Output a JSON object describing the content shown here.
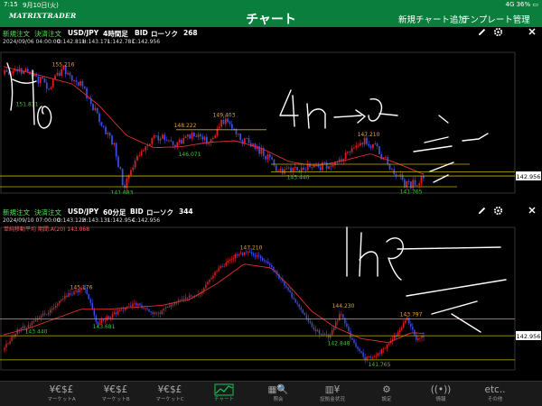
{
  "status": {
    "time": "7:15",
    "date": "9月10日(火)",
    "right": "4G 36% ▭"
  },
  "header": {
    "logo": "MATRIXTRADER",
    "title": "チャート",
    "add_chart": "新規チャート追加",
    "template": "テンプレート管理"
  },
  "panels": [
    {
      "new_order": "新規注文",
      "settle_order": "決済注文",
      "pair": "USD/JPY",
      "timeframe": "4時間足",
      "side": "BID",
      "chart_kind": "ローソク",
      "count": "268",
      "info": {
        "datetime": "2024/09/06 04:00:00",
        "open": "O:142.811",
        "high": "H:143.171",
        "low": "L:142.781",
        "close": "C:142.956"
      },
      "sma_label": "",
      "current_price": "142.956",
      "handwriting": "4h→",
      "annotations": [
        "155.216",
        "151.811",
        "148.222",
        "149.403",
        "146.071",
        "147.210",
        "143.440",
        "141.683",
        "141.765"
      ]
    },
    {
      "new_order": "新規注文",
      "settle_order": "決済注文",
      "pair": "USD/JPY",
      "timeframe": "60分足",
      "side": "BID",
      "chart_kind": "ローソク",
      "count": "344",
      "info": {
        "datetime": "2024/09/10 07:00:00",
        "open": "O:143.122",
        "high": "H:143.131",
        "low": "L:142.954",
        "close": "C:142.956"
      },
      "sma_label": "単純移動平均 期間:A(20) 143.068",
      "current_price": "142.956",
      "handwriting": "1h→",
      "annotations": [
        "147.210",
        "145.176",
        "143.440",
        "143.681",
        "144.230",
        "143.797",
        "142.848",
        "141.765"
      ]
    }
  ],
  "colors": {
    "bull": "#e02020",
    "bear": "#3a4ee8",
    "sma": "#e03030",
    "level": "#c8b400",
    "header": "#0a7e3c",
    "accent": "#19c25e"
  },
  "tabs": [
    {
      "icon": "¥€$£",
      "label": "マーケットA",
      "icon_name": "currency-icon"
    },
    {
      "icon": "¥€$£",
      "label": "マーケットB",
      "icon_name": "currency-icon"
    },
    {
      "icon": "¥€$£",
      "label": "マーケットC",
      "icon_name": "currency-icon"
    },
    {
      "icon": "",
      "label": "チャート",
      "icon_name": "chart-icon",
      "active": true
    },
    {
      "icon": "▦🔍",
      "label": "照会",
      "icon_name": "inquiry-icon"
    },
    {
      "icon": "▥¥",
      "label": "証拠金状況",
      "icon_name": "margin-icon"
    },
    {
      "icon": "⚙",
      "label": "設定",
      "icon_name": "settings-icon"
    },
    {
      "icon": "((•))",
      "label": "情報",
      "icon_name": "news-icon"
    },
    {
      "icon": "etc..",
      "label": "その他",
      "icon_name": "more-icon"
    }
  ]
}
